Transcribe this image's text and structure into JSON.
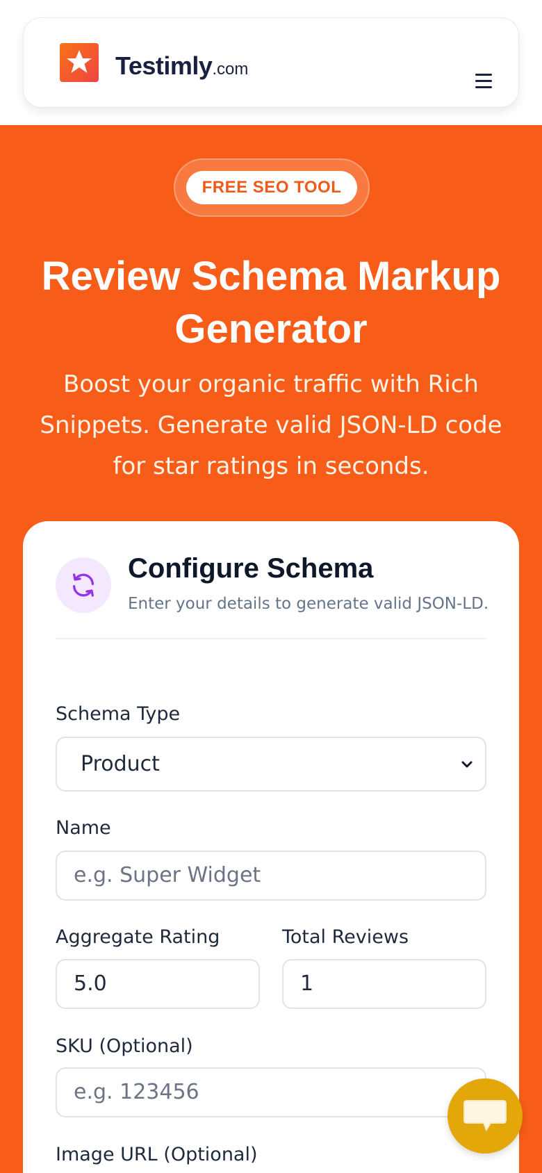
{
  "header": {
    "brand_name": "Testimly",
    "brand_tld": ".com",
    "menu_icon": "hamburger-menu-icon",
    "logo_icon": "star-icon"
  },
  "hero": {
    "badge": "FREE SEO TOOL",
    "title_line1": "Review Schema Markup",
    "title_line2": "Generator",
    "subtitle_line1": "Boost your organic traffic with Rich",
    "subtitle_line2": "Snippets. Generate valid JSON-LD code",
    "subtitle_line3": "for star ratings in seconds."
  },
  "configure": {
    "icon": "refresh-icon",
    "title": "Configure Schema",
    "subtitle": "Enter your details to generate valid JSON-LD."
  },
  "form": {
    "schema_type": {
      "label": "Schema Type",
      "value": "Product"
    },
    "name": {
      "label": "Name",
      "placeholder": "e.g. Super Widget"
    },
    "aggregate_rating": {
      "label": "Aggregate Rating",
      "value": "5.0"
    },
    "total_reviews": {
      "label": "Total Reviews",
      "value": "1"
    },
    "sku": {
      "label": "SKU (Optional)",
      "placeholder": "e.g. 123456"
    },
    "image_url": {
      "label": "Image URL (Optional)"
    }
  },
  "chat": {
    "icon": "chat-bubble-icon"
  },
  "colors": {
    "brand_orange": "#f75d18",
    "navy": "#1a2140",
    "purple_accent": "#9333ea",
    "chat_yellow": "#e3a70a"
  }
}
